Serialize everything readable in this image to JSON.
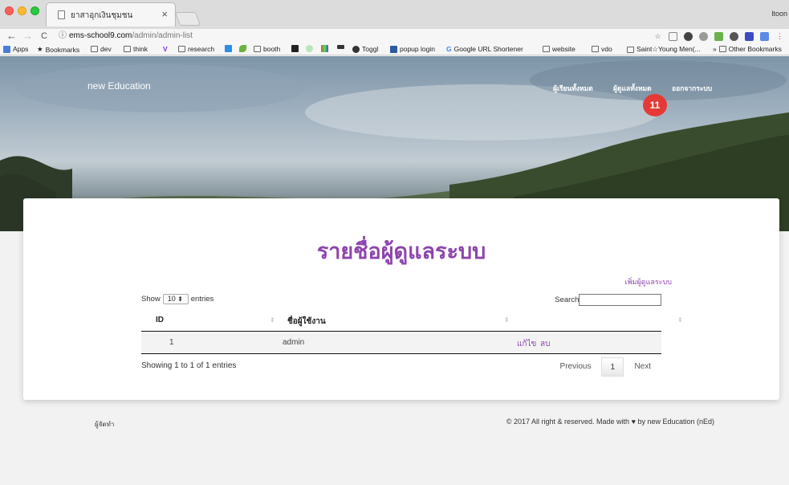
{
  "browser": {
    "tab_title": "ยาสาอุกเงินชุมชน",
    "tab_close": "×",
    "profile": "ltoon",
    "url_host": "ems-school9.com",
    "url_path": "/admin/admin-list",
    "nav": {
      "back": "←",
      "forward": "→",
      "reload": "C"
    },
    "omni_info_icon": "ⓘ",
    "star_icon": "☆",
    "menu_icon": "⋮",
    "bookmarks": [
      {
        "label": "Apps",
        "icon": "apps-grid-icon"
      },
      {
        "label": "Bookmarks",
        "icon": "star-icon"
      },
      {
        "label": "dev",
        "icon": "folder-icon"
      },
      {
        "label": "think",
        "icon": "folder-icon"
      },
      {
        "label": "",
        "icon": "v-logo-icon"
      },
      {
        "label": "research",
        "icon": "folder-icon"
      },
      {
        "label": "",
        "icon": "blue-square-icon"
      },
      {
        "label": "",
        "icon": "leaf-icon"
      },
      {
        "label": "booth",
        "icon": "folder-icon"
      },
      {
        "label": "",
        "icon": "a-logo-icon"
      },
      {
        "label": "",
        "icon": "m-logo-icon"
      },
      {
        "label": "",
        "icon": "colorful-icon"
      },
      {
        "label": "",
        "icon": "dash-icon"
      },
      {
        "label": "Toggl",
        "icon": "toggl-icon"
      },
      {
        "label": "popup login",
        "icon": "h-logo-icon"
      },
      {
        "label": "Google URL Shortener",
        "icon": "google-icon"
      },
      {
        "label": "website",
        "icon": "folder-icon"
      },
      {
        "label": "vdo",
        "icon": "folder-icon"
      },
      {
        "label": "Saint☆Young Men(...",
        "icon": "page-icon"
      }
    ],
    "other_bookmarks": "Other Bookmarks",
    "overflow": "»"
  },
  "header": {
    "brand": "new Education",
    "nav": [
      {
        "label": "ผู้เรียนทั้งหมด"
      },
      {
        "label": "ผู้ดูแลทั้งหมด"
      },
      {
        "label": "ออกจากระบบ"
      }
    ],
    "badge": "11"
  },
  "main": {
    "title": "รายชื่อผู้ดูแลระบบ",
    "add_link": "เพิ่มผู้ดูแลระบบ",
    "length": {
      "show": "Show",
      "value": "10",
      "arrow": "⬍",
      "entries": "entries"
    },
    "search_label": "Search:",
    "table": {
      "columns": [
        {
          "label": "ID"
        },
        {
          "label": "ชื่อผู้ใช้งาน"
        },
        {
          "label": ""
        }
      ],
      "rows": [
        {
          "id": "1",
          "username": "admin",
          "edit": "แก้ไข",
          "delete": "ลบ"
        }
      ]
    },
    "info": "Showing 1 to 1 of 1 entries",
    "pagination": {
      "previous": "Previous",
      "current": "1",
      "next": "Next"
    }
  },
  "footer": {
    "left": "ผู้จัดทำ",
    "right_pre": "© 2017 All right & reserved. Made with",
    "heart": "♥",
    "right_post": "by new Education (nEd)"
  },
  "colors": {
    "accent": "#8e44ad",
    "badge": "#e53935"
  }
}
